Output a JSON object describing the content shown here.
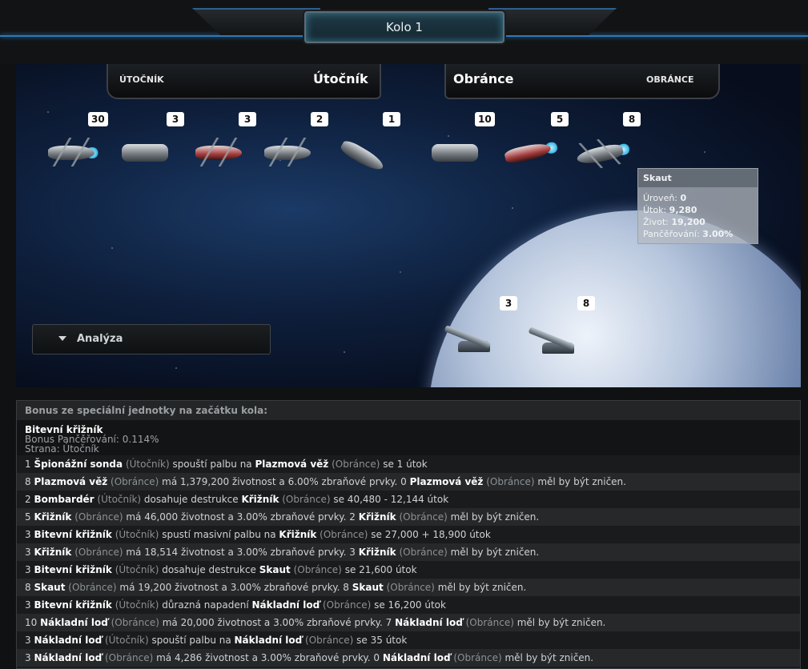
{
  "round_title": "Kolo 1",
  "attacker": {
    "label_small": "ÚTOČNÍK",
    "label_big": "Útočník"
  },
  "defender": {
    "label_small": "OBRÁNCE",
    "label_big": "Obránce"
  },
  "attacker_units": [
    {
      "count": "30"
    },
    {
      "count": "3"
    },
    {
      "count": "3"
    },
    {
      "count": "2"
    },
    {
      "count": "1"
    }
  ],
  "defender_units": [
    {
      "count": "10"
    },
    {
      "count": "5"
    },
    {
      "count": "8"
    }
  ],
  "defender_defenses": [
    {
      "count": "3"
    },
    {
      "count": "8"
    }
  ],
  "tooltip": {
    "title": "Skaut",
    "level_label": "Úroveň:",
    "level_value": "0",
    "attack_label": "Útok:",
    "attack_value": "9,280",
    "life_label": "Život:",
    "life_value": "19,200",
    "armor_label": "Pančěřování:",
    "armor_value": "3.00%"
  },
  "analysis_label": "Analýza",
  "log": {
    "header": "Bonus ze speciální jednotky na začátku kola:",
    "bonus_name": "Bitevní křižník",
    "bonus_line1": "Bonus Pančěřování: 0.114%",
    "bonus_line2": "Strana: Útočník",
    "rows": [
      {
        "a": "1 ",
        "b": "Špionážní sonda",
        "c": " (Útočník) ",
        "d": "spouští palbu na ",
        "e": "Plazmová věž",
        "f": " (Obránce) ",
        "g": "se 1 útok"
      },
      {
        "a": "8 ",
        "b": "Plazmová věž",
        "c": " (Obránce) ",
        "d": "má 1,379,200 životnost a 6.00% zbraňové prvky. 0 ",
        "e": "Plazmová věž",
        "f": " (Obránce) ",
        "g": "měl by být zničen."
      },
      {
        "a": "2 ",
        "b": "Bombardér",
        "c": " (Útočník) ",
        "d": "dosahuje destrukce ",
        "e": "Křižník",
        "f": " (Obránce) ",
        "g": "se 40,480 - 12,144 útok"
      },
      {
        "a": "5 ",
        "b": "Křižník",
        "c": " (Obránce) ",
        "d": "má 46,000 životnost a 3.00% zbraňové prvky. 2 ",
        "e": "Křižník",
        "f": " (Obránce) ",
        "g": "měl by být zničen."
      },
      {
        "a": "3 ",
        "b": "Bitevní křižník",
        "c": " (Útočník) ",
        "d": "spustí masivní palbu na ",
        "e": "Křižník",
        "f": " (Obránce) ",
        "g": "se 27,000 + 18,900 útok"
      },
      {
        "a": "3 ",
        "b": "Křižník",
        "c": " (Obránce) ",
        "d": "má 18,514 životnost a 3.00% zbraňové prvky. 3 ",
        "e": "Křižník",
        "f": " (Obránce) ",
        "g": "měl by být zničen."
      },
      {
        "a": "3 ",
        "b": "Bitevní křižník",
        "c": " (Útočník) ",
        "d": "dosahuje destrukce ",
        "e": "Skaut",
        "f": " (Obránce) ",
        "g": "se 21,600 útok"
      },
      {
        "a": "8 ",
        "b": "Skaut",
        "c": " (Obránce) ",
        "d": "má 19,200 životnost a 3.00% zbraňové prvky. 8 ",
        "e": "Skaut",
        "f": " (Obránce) ",
        "g": "měl by být zničen."
      },
      {
        "a": "3 ",
        "b": "Bitevní křižník",
        "c": " (Útočník) ",
        "d": "důrazná napadení ",
        "e": "Nákladní loď",
        "f": " (Obránce) ",
        "g": "se 16,200 útok"
      },
      {
        "a": "10 ",
        "b": "Nákladní loď",
        "c": " (Obránce) ",
        "d": "má 20,000 životnost a 3.00% zbraňové prvky. 7 ",
        "e": "Nákladní loď",
        "f": " (Obránce) ",
        "g": "měl by být zničen."
      },
      {
        "a": "3 ",
        "b": "Nákladní loď",
        "c": " (Útočník) ",
        "d": "spouští palbu na ",
        "e": "Nákladní loď",
        "f": " (Obránce) ",
        "g": "se 35 útok"
      },
      {
        "a": "3 ",
        "b": "Nákladní loď",
        "c": " (Obránce) ",
        "d": "má 4,286 životnost a 3.00% zbraňové prvky. 0 ",
        "e": "Nákladní loď",
        "f": " (Obránce) ",
        "g": "měl by být zničen."
      }
    ]
  }
}
